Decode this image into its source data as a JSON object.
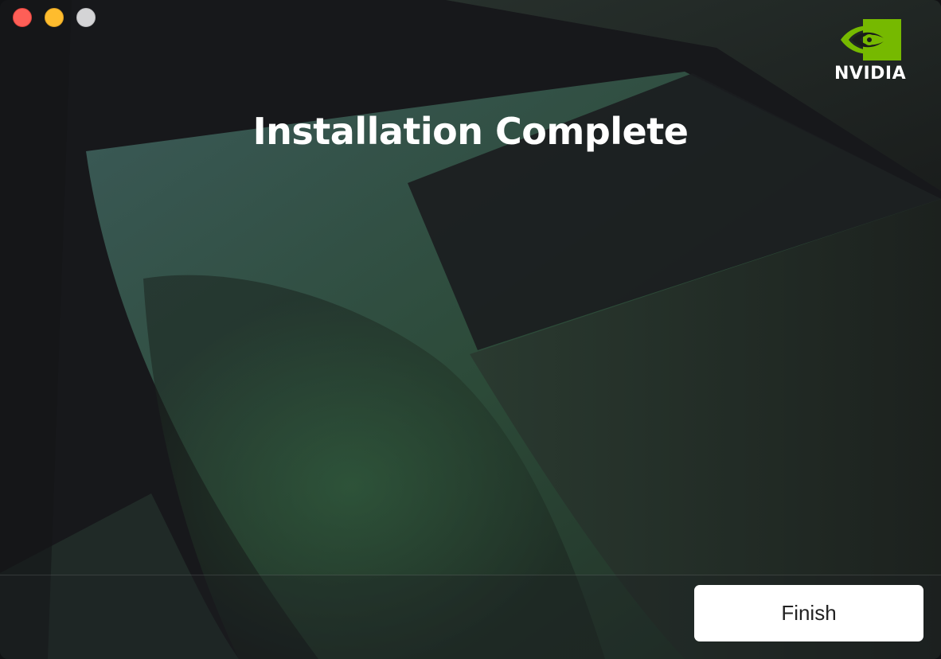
{
  "window": {
    "controls": {
      "close_icon": "close-icon",
      "minimize_icon": "minimize-icon",
      "maximize_icon": "maximize-icon"
    }
  },
  "brand": {
    "logo_text": "NVIDIA",
    "accent_color": "#76b900"
  },
  "main": {
    "title": "Installation Complete"
  },
  "footer": {
    "finish_label": "Finish"
  }
}
